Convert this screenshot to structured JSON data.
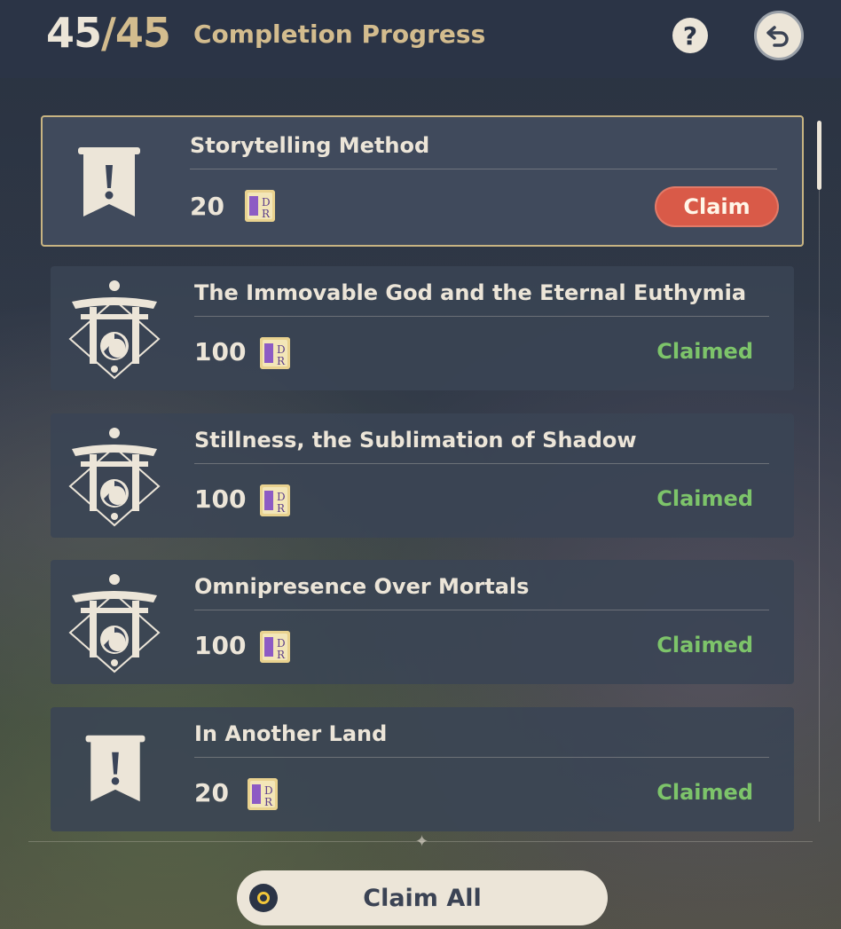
{
  "header": {
    "current": "45",
    "separator": "/",
    "total": "45",
    "title": "Completion Progress",
    "help_label": "?",
    "help_icon": "question-icon",
    "back_icon": "return-arrow-icon"
  },
  "tasks": [
    {
      "title": "Storytelling Method",
      "amount": "20",
      "status": "Claim",
      "emblem": "exclamation-banner-icon",
      "reward_icon": "travelers-notes-icon"
    },
    {
      "title": "The Immovable God and the Eternal Euthymia",
      "amount": "100",
      "status": "Claimed",
      "emblem": "torii-gate-emblem-icon",
      "reward_icon": "travelers-notes-icon"
    },
    {
      "title": "Stillness, the Sublimation of Shadow",
      "amount": "100",
      "status": "Claimed",
      "emblem": "torii-gate-emblem-icon",
      "reward_icon": "travelers-notes-icon"
    },
    {
      "title": "Omnipresence Over Mortals",
      "amount": "100",
      "status": "Claimed",
      "emblem": "torii-gate-emblem-icon",
      "reward_icon": "travelers-notes-icon"
    },
    {
      "title": "In Another Land",
      "amount": "20",
      "status": "Claimed",
      "emblem": "exclamation-banner-icon",
      "reward_icon": "travelers-notes-icon"
    }
  ],
  "footer": {
    "claim_all_label": "Claim All",
    "key_icon": "controller-button-icon"
  },
  "colors": {
    "header_bg": "#2b3446",
    "gold": "#d3bc8e",
    "cream": "#ece5d8",
    "claim_button": "#d95a48",
    "claimed_text": "#7dc46a"
  }
}
